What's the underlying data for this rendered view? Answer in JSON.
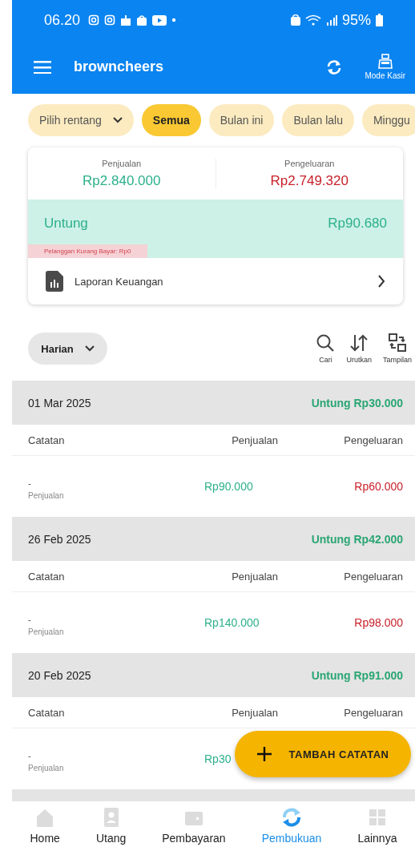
{
  "status_bar": {
    "time": "06.20",
    "battery": "95%"
  },
  "app_bar": {
    "title": "browncheers",
    "cashier_label": "Mode Kasir"
  },
  "filters": [
    {
      "label": "Pilih rentang",
      "kind": "dropdown",
      "selected": false
    },
    {
      "label": "Semua",
      "kind": "chip",
      "selected": true
    },
    {
      "label": "Bulan ini",
      "kind": "chip",
      "selected": false
    },
    {
      "label": "Bulan lalu",
      "kind": "chip",
      "selected": false
    },
    {
      "label": "Minggu",
      "kind": "chip",
      "selected": false
    }
  ],
  "summary": {
    "sales_label": "Penjualan",
    "sales_value": "Rp2.840.000",
    "expense_label": "Pengeluaran",
    "expense_value": "Rp2.749.320",
    "profit_label": "Untung",
    "profit_value": "Rp90.680",
    "unpaid_note": "Pelanggan Kurang Bayar: Rp0",
    "report_link": "Laporan Keuangan"
  },
  "toolbar": {
    "period": "Harian",
    "actions": [
      {
        "kind": "search",
        "label": "Cari"
      },
      {
        "kind": "sort",
        "label": "Urutkan"
      },
      {
        "kind": "view",
        "label": "Tampilan"
      }
    ]
  },
  "days": [
    {
      "date": "01 Mar 2025",
      "profit": "Untung Rp30.000",
      "columns": [
        "Catatan",
        "Penjualan",
        "Pengeluaran"
      ],
      "entries": [
        {
          "note": "-",
          "type": "Penjualan",
          "sales": "Rp90.000",
          "expense": "Rp60.000"
        }
      ]
    },
    {
      "date": "26 Feb 2025",
      "profit": "Untung Rp42.000",
      "columns": [
        "Catatan",
        "Penjualan",
        "Pengeluaran"
      ],
      "entries": [
        {
          "note": "-",
          "type": "Penjualan",
          "sales": "Rp140.000",
          "expense": "Rp98.000"
        }
      ]
    },
    {
      "date": "20 Feb 2025",
      "profit": "Untung Rp91.000",
      "columns": [
        "Catatan",
        "Penjualan",
        "Pengeluaran"
      ],
      "entries": [
        {
          "note": "-",
          "type": "Penjualan",
          "sales": "Rp30"
        }
      ]
    }
  ],
  "fab": {
    "label": "TAMBAH CATATAN"
  },
  "nav": [
    {
      "kind": "home",
      "label": "Home",
      "selected": false
    },
    {
      "kind": "debt",
      "label": "Utang",
      "selected": false
    },
    {
      "kind": "wallet",
      "label": "Pembayaran",
      "selected": false
    },
    {
      "kind": "sync",
      "label": "Pembukuan",
      "selected": true
    },
    {
      "kind": "grid",
      "label": "Lainnya",
      "selected": false
    }
  ]
}
